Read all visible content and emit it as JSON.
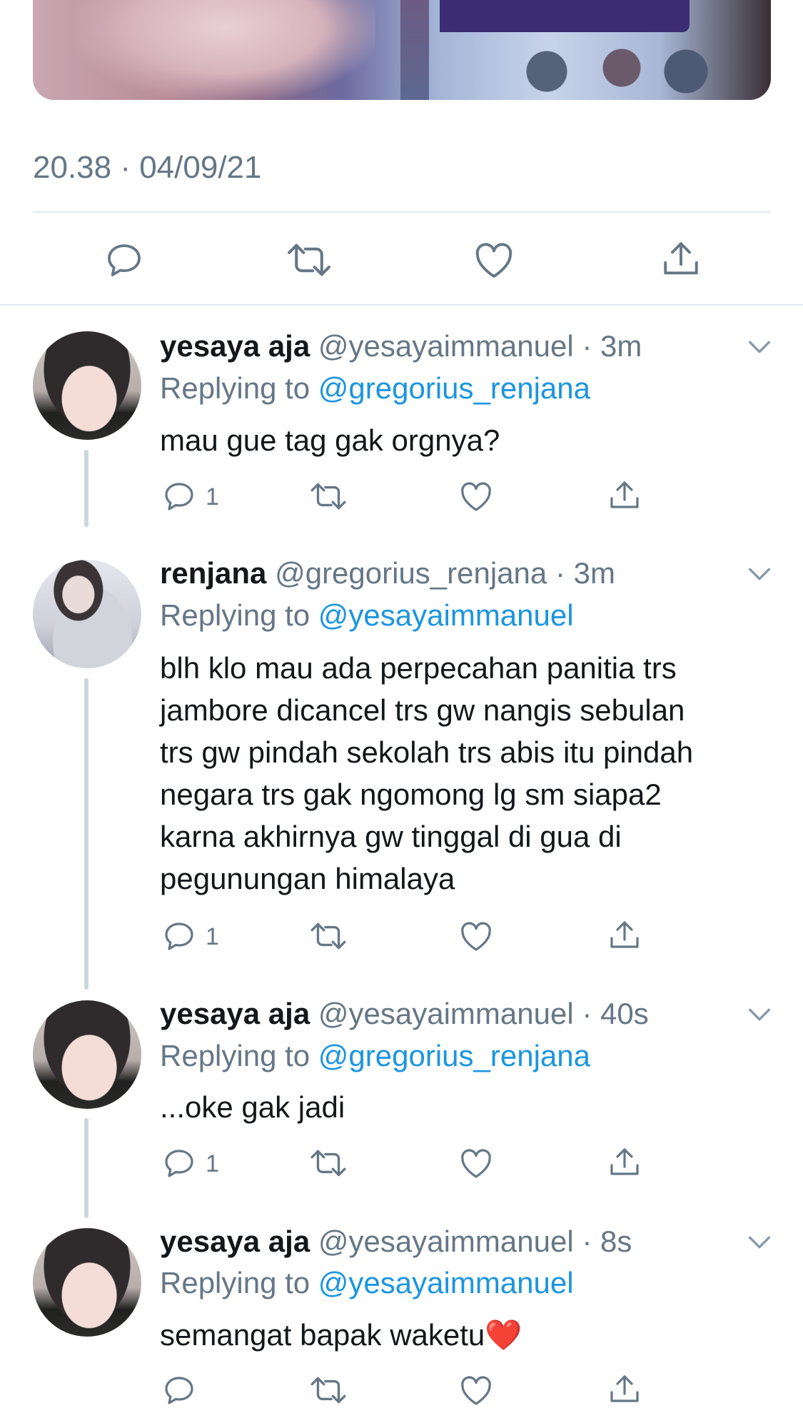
{
  "tweet": {
    "timestamp": "20.38 · 04/09/21"
  },
  "replies": [
    {
      "name": "yesaya aja",
      "handle_time": "@yesayaimmanuel · 3m",
      "replying_prefix": "Replying to ",
      "replying_to": "@gregorius_renjana",
      "text": "mau gue tag gak orgnya?",
      "reply_count": "1"
    },
    {
      "name": "renjana",
      "handle_time": "@gregorius_renjana · 3m",
      "replying_prefix": "Replying to ",
      "replying_to": "@yesayaimmanuel",
      "text_lines": [
        "blh klo mau ada perpecahan panitia trs",
        "jambore dicancel trs gw nangis sebulan",
        "trs gw pindah sekolah trs abis itu pindah",
        "negara trs gak ngomong lg sm siapa2",
        "karna akhirnya gw tinggal di gua di",
        "pegunungan himalaya"
      ],
      "reply_count": "1"
    },
    {
      "name": "yesaya aja",
      "handle_time": "@yesayaimmanuel · 40s",
      "replying_prefix": "Replying to ",
      "replying_to": "@gregorius_renjana",
      "text": "...oke gak jadi",
      "reply_count": "1"
    },
    {
      "name": "yesaya aja",
      "handle_time": "@yesayaimmanuel · 8s",
      "replying_prefix": "Replying to ",
      "replying_to": "@yesayaimmanuel",
      "text": "semangat bapak waketu",
      "emoji": "❤️"
    }
  ],
  "icons": {
    "reply": "speech-bubble-icon",
    "retweet": "retweet-arrows-icon",
    "like": "heart-icon",
    "share": "share-upload-icon",
    "caret": "chevron-down-icon"
  },
  "colors": {
    "mention": "#1b95e0",
    "muted": "#657786",
    "divider": "#e1e8ed",
    "thread_line": "#ccd6dd"
  }
}
